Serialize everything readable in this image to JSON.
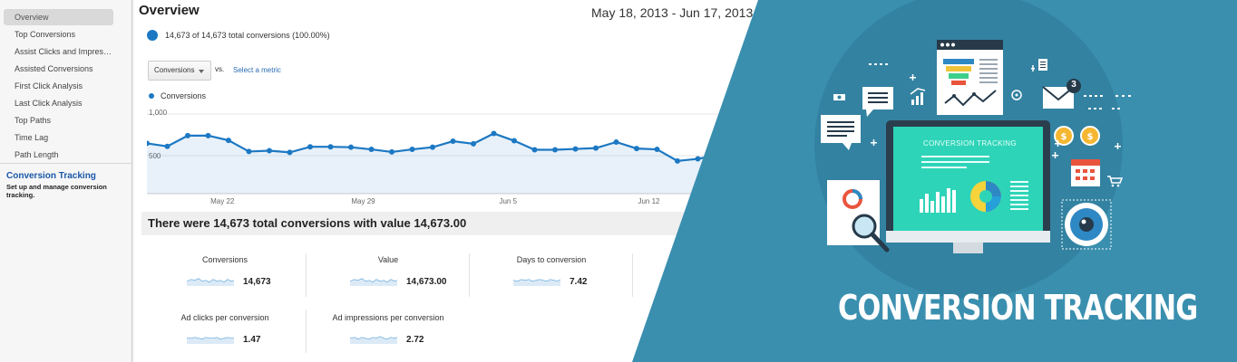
{
  "sidebar": {
    "items": [
      {
        "label": "Overview",
        "active": true
      },
      {
        "label": "Top Conversions"
      },
      {
        "label": "Assist Clicks and Impressions"
      },
      {
        "label": "Assisted Conversions"
      },
      {
        "label": "First Click Analysis"
      },
      {
        "label": "Last Click Analysis"
      },
      {
        "label": "Top Paths"
      },
      {
        "label": "Time Lag"
      },
      {
        "label": "Path Length"
      }
    ],
    "help_title": "Conversion Tracking",
    "help_desc": "Set up and manage conversion tracking."
  },
  "main": {
    "title": "Overview",
    "date_range": "May 18, 2013 - Jun 17, 2013",
    "summary": "14,673 of 14,673 total conversions (100.00%)",
    "metric_select": "Conversions",
    "vs_label": "vs.",
    "select_metric_link": "Select a metric",
    "headline": "There were 14,673 total conversions with value 14,673.00",
    "kpis": [
      {
        "label": "Conversions",
        "value": "14,673"
      },
      {
        "label": "Value",
        "value": "14,673.00"
      },
      {
        "label": "Days to conversion",
        "value": "7.42"
      },
      {
        "label": "Ad clicks per conversion",
        "value": "1.47"
      },
      {
        "label": "Ad impressions per conversion",
        "value": "2.72"
      }
    ]
  },
  "chart_data": {
    "type": "area",
    "series": [
      {
        "name": "Conversions",
        "values": [
          585,
          550,
          675,
          675,
          620,
          490,
          500,
          480,
          545,
          545,
          540,
          515,
          485,
          515,
          540,
          610,
          580,
          700,
          615,
          510,
          510,
          520,
          530,
          600,
          525,
          515,
          380,
          405,
          450
        ]
      }
    ],
    "x_tick_labels": [
      "May 22",
      "May 29",
      "Jun 5",
      "Jun 12"
    ],
    "y_tick_labels": [
      "1,000",
      "500"
    ],
    "ylim": [
      0,
      1000
    ],
    "color": "#1c78c3",
    "grid": true
  },
  "banner": {
    "title": "CONVERSION TRACKING",
    "screen_title": "CONVERSION TRACKING",
    "notification_count": "3",
    "background": "#3a8faf",
    "accent": "#2ed4b8"
  }
}
